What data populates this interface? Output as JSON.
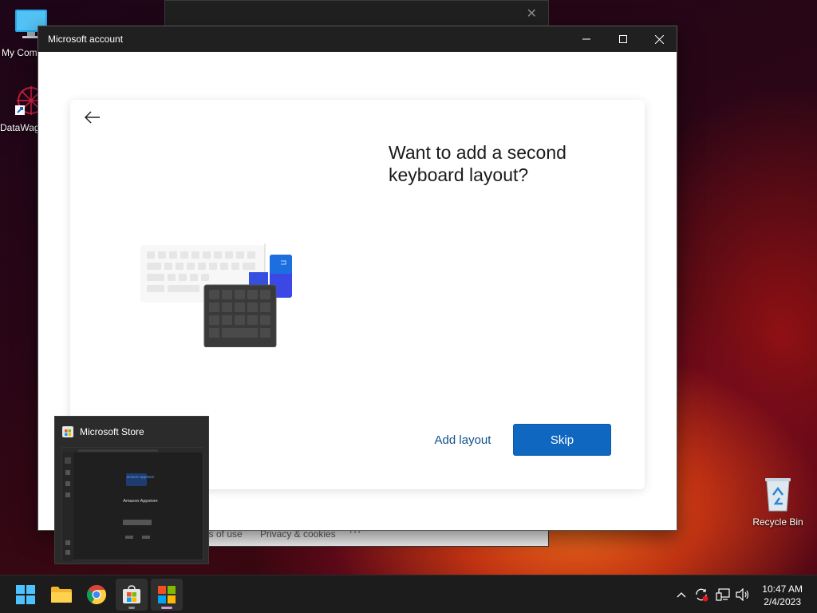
{
  "desktop": {
    "icons": [
      {
        "label": "My Com",
        "icon": "computer-icon"
      },
      {
        "label": "DataWag",
        "icon": "datawag-icon"
      },
      {
        "label": "Recycle Bin",
        "icon": "recycle-bin-icon"
      }
    ]
  },
  "background_window": {
    "footer_items": [
      "ns of use",
      "Privacy & cookies",
      "···"
    ]
  },
  "window": {
    "title": "Microsoft account",
    "heading": "Want to add a second keyboard layout?",
    "buttons": {
      "add_layout": "Add layout",
      "skip": "Skip"
    },
    "accent": "#0f67c0"
  },
  "taskbar_thumbnail": {
    "title": "Microsoft Store",
    "preview_title": "Amazon Appstore",
    "preview_logo": "amazon appstore"
  },
  "taskbar": {
    "apps": [
      "start-icon",
      "file-explorer-icon",
      "chrome-icon",
      "microsoft-store-icon",
      "microsoft-account-icon"
    ],
    "clock": {
      "time": "10:47 AM",
      "date": "2/4/2023"
    }
  }
}
